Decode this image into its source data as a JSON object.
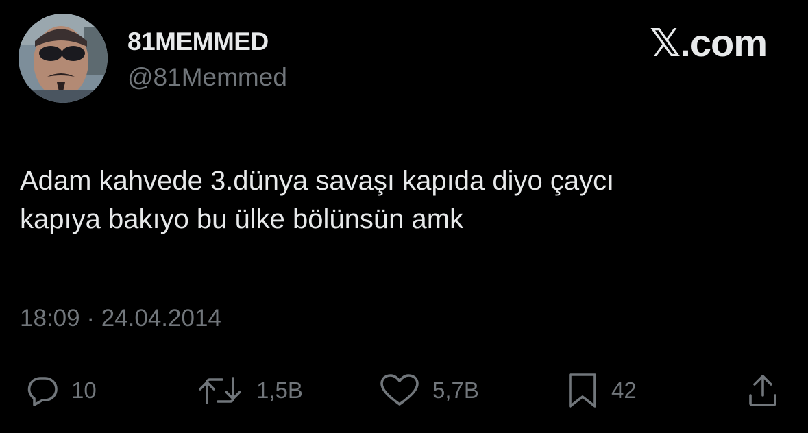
{
  "user": {
    "display_name": "81MEMMED",
    "handle": "@81Memmed"
  },
  "brand": "𝕏.com",
  "tweet": {
    "text": "Adam kahvede 3.dünya savaşı kapıda diyo çaycı\nkapıya bakıyo bu ülke bölünsün amk",
    "time": "18:09",
    "separator": "·",
    "date": "24.04.2014"
  },
  "actions": {
    "reply": {
      "icon": "reply-bubble-icon",
      "count": "10"
    },
    "retweet": {
      "icon": "retweet-icon",
      "count": "1,5B"
    },
    "like": {
      "icon": "heart-icon",
      "count": "5,7B"
    },
    "bookmark": {
      "icon": "bookmark-icon",
      "count": "42"
    },
    "share": {
      "icon": "share-icon"
    }
  },
  "colors": {
    "background": "#000000",
    "primary_text": "#e7e9ea",
    "secondary_text": "#71767b"
  }
}
